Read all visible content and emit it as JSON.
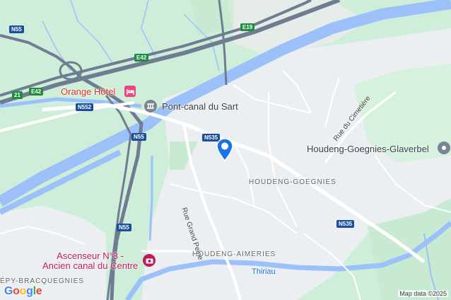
{
  "map": {
    "labels": {
      "orange_hotel": "Orange Hôtel",
      "pont_canal": "Pont-canal du Sart",
      "houdeng_glaverbel": "Houdeng-Goegnies-Glaverbel",
      "houdeng_goegnies": "HOUDENG-GOEGNIES",
      "houdeng_aimeries": "HOUDENG-AIMERIES",
      "ascenseur_line1": "Ascenseur N°3 -",
      "ascenseur_line2": "Ancien canal du Centre",
      "bracquegnies": "ÉPY-BRACQUEGNIES",
      "thiriau": "Thiriau",
      "rue_grand_peine": "Rue Grand Peine",
      "rue_cimetiere": "Rue du Cimetière"
    },
    "road_shields": {
      "n55_top": "N55",
      "e19": "E19",
      "e42_a": "E42",
      "e42_b": "E42",
      "a21": "21",
      "n552": "N552",
      "n55_mid": "N55",
      "n535_a": "N535",
      "n535_b": "N535",
      "n55_low": "N55"
    },
    "attribution": "Map data ©2025",
    "logo": [
      "G",
      "o",
      "o",
      "g",
      "l",
      "e"
    ],
    "icons": [
      "hotel-icon",
      "bridge-icon",
      "landmark-icon",
      "museum-icon",
      "location-pin-icon"
    ],
    "colors": {
      "water": "#9cc0f9",
      "green": "#c6e9d2",
      "urban": "#eceff1",
      "highway": "#6f7c92",
      "pin": "#1a73e8",
      "hotel_marker": "#e8467c"
    }
  }
}
